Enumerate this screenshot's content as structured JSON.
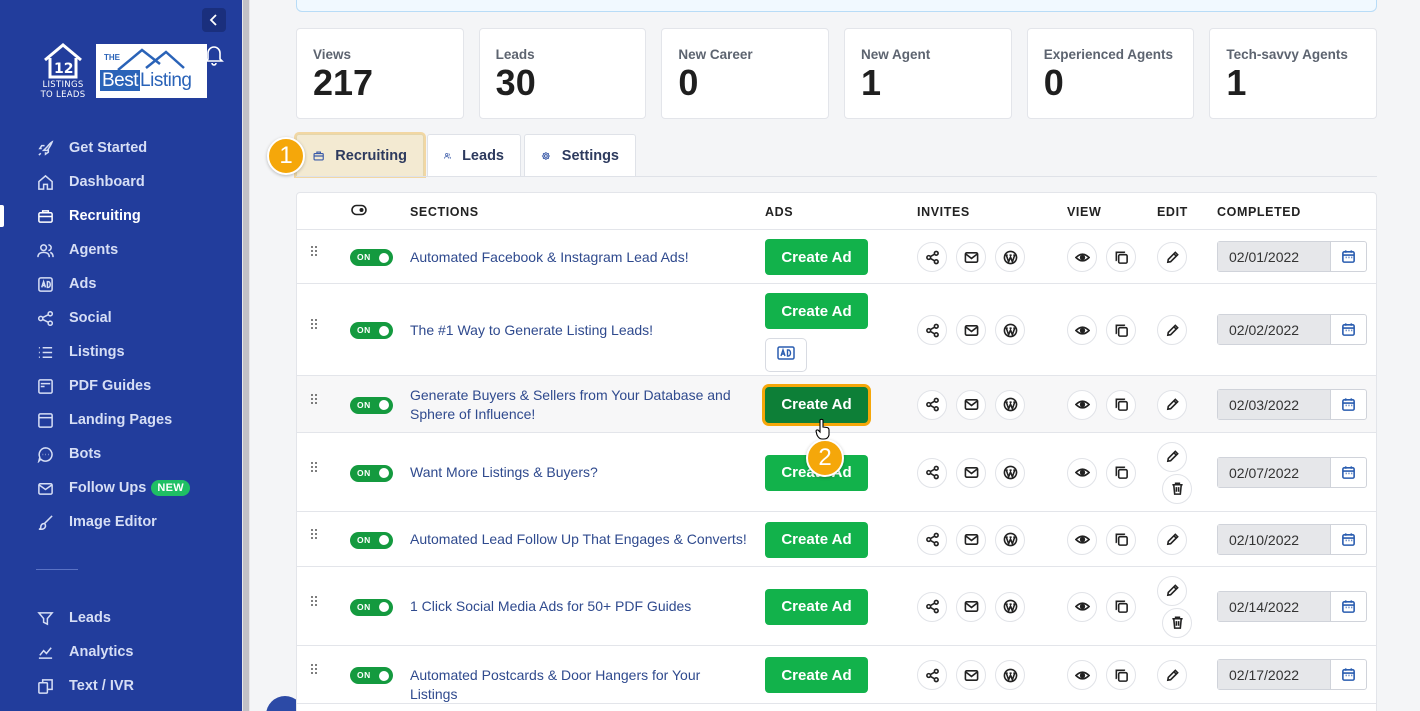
{
  "sidebar": {
    "brand": {
      "line1": "LISTINGS",
      "line2": "TO LEADS"
    },
    "partner": {
      "the": "THE",
      "best": "Best",
      "listing": "Listing"
    },
    "items": [
      {
        "label": "Get Started",
        "icon": "rocket-icon"
      },
      {
        "label": "Dashboard",
        "icon": "home-icon"
      },
      {
        "label": "Recruiting",
        "icon": "briefcase-icon",
        "active": true
      },
      {
        "label": "Agents",
        "icon": "users-icon"
      },
      {
        "label": "Ads",
        "icon": "ad-icon"
      },
      {
        "label": "Social",
        "icon": "share-icon"
      },
      {
        "label": "Listings",
        "icon": "list-icon"
      },
      {
        "label": "PDF Guides",
        "icon": "pdf-icon"
      },
      {
        "label": "Landing Pages",
        "icon": "browser-icon"
      },
      {
        "label": "Bots",
        "icon": "chat-icon"
      },
      {
        "label": "Follow Ups",
        "icon": "mail-icon",
        "badge": "NEW"
      },
      {
        "label": "Image Editor",
        "icon": "brush-icon"
      }
    ],
    "items2": [
      {
        "label": "Leads",
        "icon": "filter-icon"
      },
      {
        "label": "Analytics",
        "icon": "chart-icon"
      },
      {
        "label": "Text / IVR",
        "icon": "phone-icon"
      }
    ]
  },
  "stats": [
    {
      "label": "Views",
      "value": "217"
    },
    {
      "label": "Leads",
      "value": "30"
    },
    {
      "label": "New Career",
      "value": "0"
    },
    {
      "label": "New Agent",
      "value": "1"
    },
    {
      "label": "Experienced Agents",
      "value": "0"
    },
    {
      "label": "Tech-savvy Agents",
      "value": "1"
    }
  ],
  "tabs": [
    {
      "label": "Recruiting",
      "icon": "briefcase-icon",
      "active": true
    },
    {
      "label": "Leads",
      "icon": "users-icon"
    },
    {
      "label": "Settings",
      "icon": "gear-icon"
    }
  ],
  "steps": {
    "one": "1",
    "two": "2"
  },
  "table": {
    "headers": {
      "sections": "SECTIONS",
      "ads": "ADS",
      "invites": "INVITES",
      "view": "VIEW",
      "edit": "EDIT",
      "completed": "COMPLETED"
    },
    "rows": [
      {
        "toggle": "ON",
        "section": "Automated Facebook & Instagram Lead Ads!",
        "button": "Create Ad",
        "completed": "02/01/2022"
      },
      {
        "toggle": "ON",
        "section": "The #1 Way to Generate Listing Leads!",
        "button": "Create Ad",
        "completed": "02/02/2022",
        "adbadge": true
      },
      {
        "toggle": "ON",
        "section": "Generate Buyers & Sellers from Your Database and Sphere of Influence!",
        "button": "Create Ad",
        "completed": "02/03/2022",
        "focused": true
      },
      {
        "toggle": "ON",
        "section": "Want More Listings & Buyers?",
        "button": "Create Ad",
        "completed": "02/07/2022",
        "trash": true
      },
      {
        "toggle": "ON",
        "section": "Automated Lead Follow Up That Engages & Converts!",
        "button": "Create Ad",
        "completed": "02/10/2022"
      },
      {
        "toggle": "ON",
        "section": "1 Click Social Media Ads for 50+ PDF Guides",
        "button": "Create Ad",
        "completed": "02/14/2022",
        "trash": true
      },
      {
        "toggle": "ON",
        "section": "Automated Postcards & Door Hangers for Your Listings",
        "button": "Create Ad",
        "completed": "02/17/2022"
      }
    ]
  },
  "colors": {
    "sidebar": "#223d9c",
    "accent_green": "#12b24b",
    "step_orange": "#f5a70a",
    "link": "#2f4a8e"
  }
}
